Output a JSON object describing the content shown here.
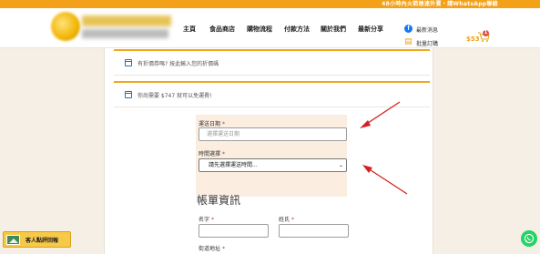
{
  "topbar": {
    "text": "48小時內火箭極速外賣・請WhatsApp聯絡"
  },
  "nav": {
    "main": "主頁",
    "shop": "食品商店",
    "flow": "購物流程",
    "pay": "付款方法",
    "about": "關於我們",
    "share": "最新分享"
  },
  "header_links": {
    "news": "最新消息",
    "bulk": "批量訂購"
  },
  "cart": {
    "price": "$53",
    "count": "1"
  },
  "notices": {
    "coupon": "有折價券嗎? 按此輸入您的折價碼",
    "freeship": "你尚需要 $747 就可以免運費!"
  },
  "delivery": {
    "date_label": "運送日期",
    "date_placeholder": "選擇運送日期",
    "time_label": "時間選擇",
    "time_value": "請先選擇運送時間..."
  },
  "billing": {
    "title": "帳單資訊",
    "first_name": "名字",
    "last_name": "姓氏",
    "address": "街道地址",
    "required_mark": "*"
  },
  "review_button": "客人點評回報",
  "colors": {
    "accent": "#f4a11a",
    "arrow": "#d62020",
    "whatsapp": "#25d366"
  }
}
